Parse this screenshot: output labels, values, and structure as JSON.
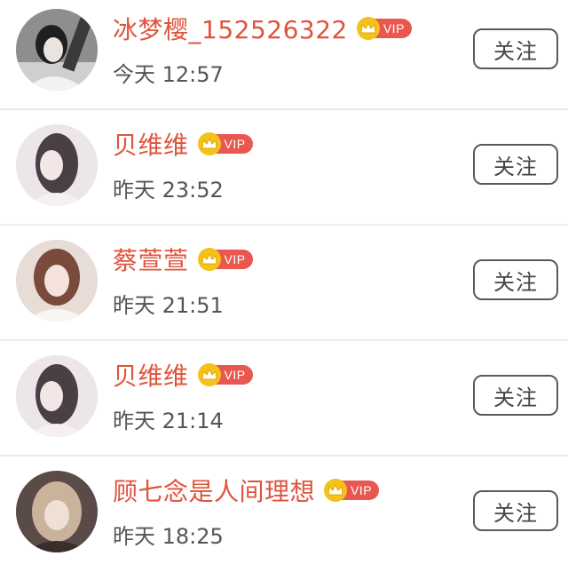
{
  "rows": [
    {
      "name": "冰梦樱_152526322",
      "time": "今天 12:57",
      "vip_label": "VIP",
      "follow_label": "关注"
    },
    {
      "name": "贝维维",
      "time": "昨天 23:52",
      "vip_label": "VIP",
      "follow_label": "关注"
    },
    {
      "name": "蔡萱萱",
      "time": "昨天 21:51",
      "vip_label": "VIP",
      "follow_label": "关注"
    },
    {
      "name": "贝维维",
      "time": "昨天 21:14",
      "vip_label": "VIP",
      "follow_label": "关注"
    },
    {
      "name": "顾七念是人间理想",
      "time": "昨天 18:25",
      "vip_label": "VIP",
      "follow_label": "关注"
    }
  ],
  "colors": {
    "name": "#e0533c",
    "vip_badge": "#e8584f",
    "crown": "#f5c21b",
    "time": "#555555",
    "divider": "#ebebeb"
  },
  "icons": {
    "avatar": "user-avatar",
    "vip": "crown-icon"
  }
}
